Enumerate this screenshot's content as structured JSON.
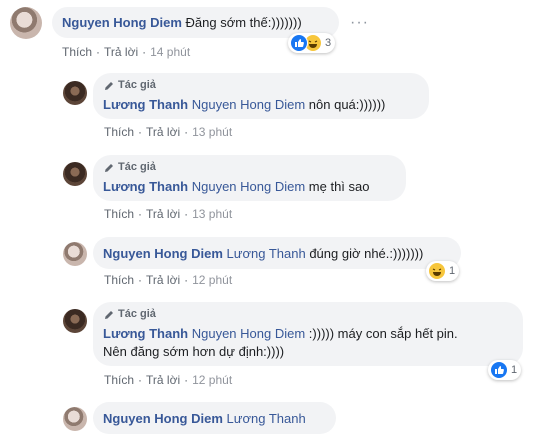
{
  "comments": [
    {
      "author": "Nguyen Hong Diem",
      "mention": "",
      "text": "Đăng sớm thế:)))))))",
      "like_label": "Thích",
      "reply_label": "Trả lời",
      "time": "14 phút",
      "reaction_count": "3"
    },
    {
      "author_tag": "Tác giả",
      "author": "Lương Thanh",
      "mention": "Nguyen Hong Diem",
      "text": "nôn quá:))))))",
      "like_label": "Thích",
      "reply_label": "Trả lời",
      "time": "13 phút"
    },
    {
      "author_tag": "Tác giả",
      "author": "Lương Thanh",
      "mention": "Nguyen Hong Diem",
      "text": "mẹ thì sao",
      "like_label": "Thích",
      "reply_label": "Trả lời",
      "time": "13 phút"
    },
    {
      "author": "Nguyen Hong Diem",
      "mention": "Lương Thanh",
      "text": "đúng giờ nhé.:)))))))",
      "like_label": "Thích",
      "reply_label": "Trả lời",
      "time": "12 phút",
      "reaction_count": "1"
    },
    {
      "author_tag": "Tác giả",
      "author": "Lương Thanh",
      "mention": "Nguyen Hong Diem",
      "text": ":))))) máy con sắp hết pin.",
      "text_line2": "Nên đăng sớm hơn dự định:))))",
      "like_label": "Thích",
      "reply_label": "Trả lời",
      "time": "12 phút",
      "reaction_count": "1"
    },
    {
      "author": "Nguyen Hong Diem",
      "mention": "Lương Thanh",
      "text": ""
    }
  ],
  "more_label": "···",
  "colors": {
    "link": "#385898",
    "bubble": "#f2f3f5",
    "like": "#1877f2",
    "haha": "#f7c63c"
  },
  "icons": {
    "author_tag": "pencil-icon",
    "like_reaction": "like-reaction-icon",
    "haha_reaction": "haha-reaction-icon"
  }
}
